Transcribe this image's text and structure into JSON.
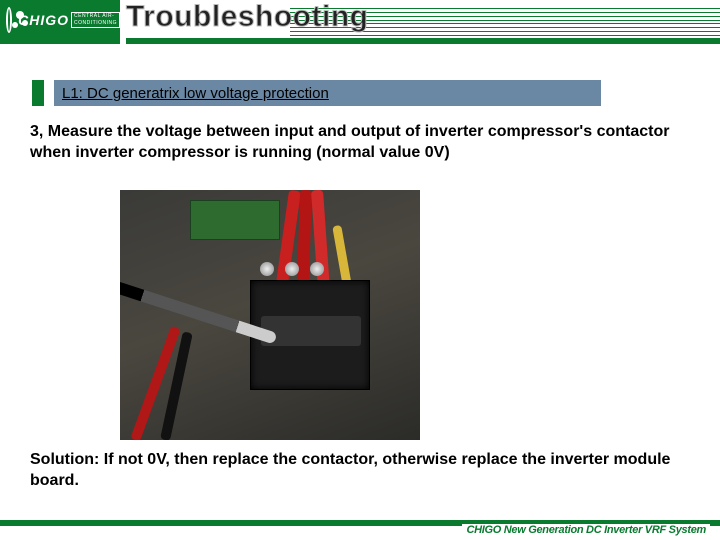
{
  "header": {
    "brand": "CHIGO",
    "brand_sub": "CENTRAL AIR-CONDITIONING",
    "title": "Troubleshooting"
  },
  "section": {
    "label": "L1: DC generatrix low voltage protection"
  },
  "body": {
    "step": "3, Measure the voltage between input and output of inverter compressor's contactor when inverter compressor is running (normal value 0V)",
    "solution": "Solution: If not 0V, then replace the contactor, otherwise replace the inverter module board."
  },
  "footer": {
    "text": "CHIGO New Generation DC Inverter VRF System"
  }
}
